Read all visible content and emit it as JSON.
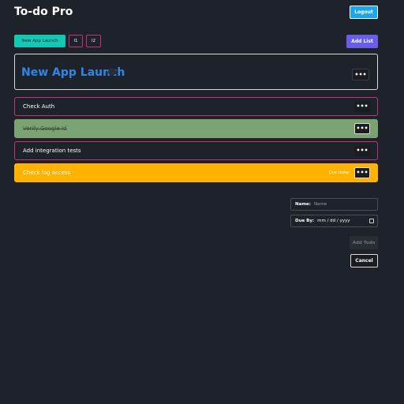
{
  "app": {
    "title": "To-do Pro",
    "logout_label": "Logout"
  },
  "lists": {
    "tabs": [
      {
        "label": "New App Launch",
        "active": true
      },
      {
        "label": "l1",
        "active": false
      },
      {
        "label": "l2",
        "active": false
      }
    ],
    "add_label": "Add List"
  },
  "current_list": {
    "name": "New App Launch",
    "more_label": "•••"
  },
  "todos": [
    {
      "text": "Check Auth",
      "status": "open",
      "more_label": "•••"
    },
    {
      "text": "Verify Google Id",
      "status": "done",
      "more_label": "•••"
    },
    {
      "text": "Add integration tests",
      "status": "open",
      "more_label": "•••"
    },
    {
      "text": "Check log access",
      "status": "due",
      "due_label": "Due today",
      "more_label": "•••"
    }
  ],
  "form": {
    "name_label": "Name:",
    "name_placeholder": "Name",
    "due_label": "Due By:",
    "due_placeholder": "mm / dd / yyyy",
    "add_label": "Add Todo",
    "cancel_label": "Cancel"
  },
  "colors": {
    "background": "#1e222b",
    "accent_teal": "#13c9b4",
    "logout_blue": "#1ea7e8",
    "add_list_purple": "#6a5de8",
    "todo_border": "#c9327b",
    "done_green": "#7ba372",
    "due_amber": "#ffb300",
    "list_title_blue": "#2f86e8"
  }
}
